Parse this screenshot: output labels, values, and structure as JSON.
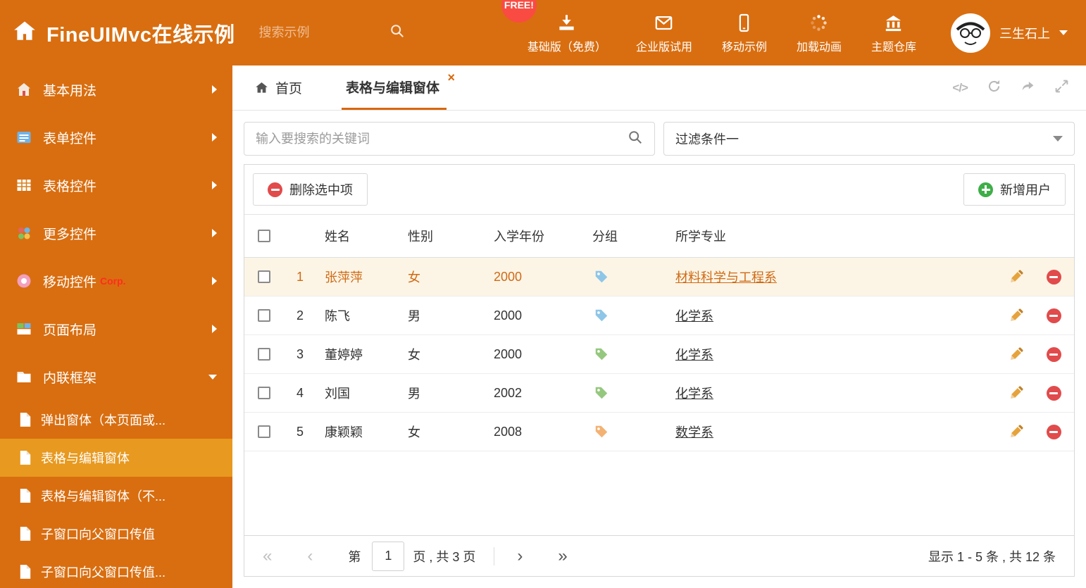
{
  "colors": {
    "header_bg": "#d96e10",
    "accent": "#d9670b",
    "active_menu_bg": "#e8991f",
    "selected_row_bg": "#fcf5e6",
    "selected_row_text": "#cf6a14",
    "free_badge_bg": "#fa4b42",
    "delete_red": "#e14b4b",
    "add_green": "#3fae49"
  },
  "header": {
    "title": "FineUIMvc在线示例",
    "search_placeholder": "搜索示例",
    "free_badge": "FREE!",
    "nav": [
      "基础版（免费）",
      "企业版试用",
      "移动示例",
      "加载动画",
      "主题仓库"
    ],
    "user_name": "三生石上"
  },
  "sidebar": {
    "items": [
      {
        "label": "基本用法"
      },
      {
        "label": "表单控件"
      },
      {
        "label": "表格控件"
      },
      {
        "label": "更多控件"
      },
      {
        "label": "移动控件",
        "badge": "Corp."
      },
      {
        "label": "页面布局"
      },
      {
        "label": "内联框架",
        "expanded": true
      }
    ],
    "subitems": [
      {
        "label": "弹出窗体（本页面或..."
      },
      {
        "label": "表格与编辑窗体",
        "active": true
      },
      {
        "label": "表格与编辑窗体（不..."
      },
      {
        "label": "子窗口向父窗口传值"
      },
      {
        "label": "子窗口向父窗口传值..."
      }
    ]
  },
  "tabs": {
    "home": "首页",
    "active": "表格与编辑窗体",
    "close": "×",
    "code_icon": "</>"
  },
  "filter": {
    "search_placeholder": "输入要搜索的关键词",
    "selected_filter": "过滤条件一"
  },
  "toolbar": {
    "delete_label": "删除选中项",
    "add_label": "新增用户"
  },
  "table": {
    "columns": [
      "姓名",
      "性别",
      "入学年份",
      "分组",
      "所学专业"
    ],
    "rows": [
      {
        "num": "1",
        "name": "张萍萍",
        "gender": "女",
        "year": "2000",
        "tag_color": "#8ec6e8",
        "major": "材料科学与工程系",
        "selected": true
      },
      {
        "num": "2",
        "name": "陈飞",
        "gender": "男",
        "year": "2000",
        "tag_color": "#8ec6e8",
        "major": "化学系"
      },
      {
        "num": "3",
        "name": "董婷婷",
        "gender": "女",
        "year": "2000",
        "tag_color": "#95c87e",
        "major": "化学系"
      },
      {
        "num": "4",
        "name": "刘国",
        "gender": "男",
        "year": "2002",
        "tag_color": "#95c87e",
        "major": "化学系"
      },
      {
        "num": "5",
        "name": "康颖颖",
        "gender": "女",
        "year": "2008",
        "tag_color": "#f3b273",
        "major": "数学系"
      }
    ]
  },
  "pagination": {
    "page_prefix": "第",
    "current_page": "1",
    "page_suffix": "页 , 共 3 页",
    "summary": "显示 1 - 5 条 , 共 12 条"
  }
}
